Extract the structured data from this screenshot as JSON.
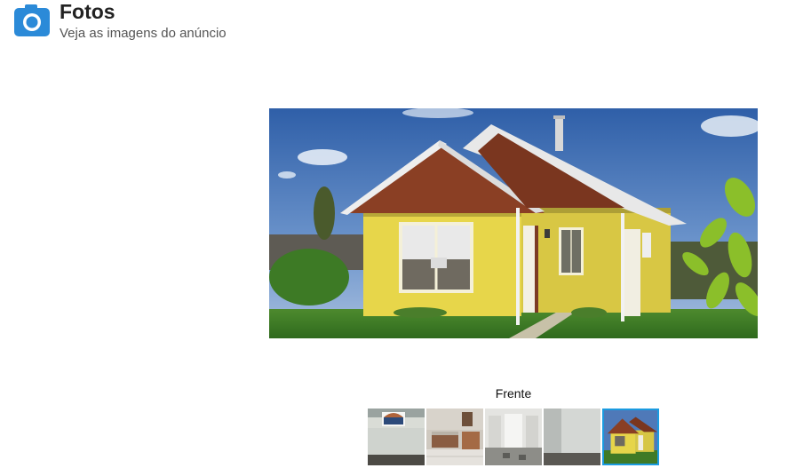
{
  "header": {
    "title": "Fotos",
    "subtitle": "Veja as imagens do anúncio",
    "icon": "camera-icon"
  },
  "gallery": {
    "caption": "Frente",
    "accent_color": "#1b9be0",
    "selected_index": 4,
    "thumbnails": [
      {
        "name": "interior-window-arch"
      },
      {
        "name": "kitchen-room"
      },
      {
        "name": "hallway-doors"
      },
      {
        "name": "empty-room"
      },
      {
        "name": "house-front"
      }
    ]
  }
}
